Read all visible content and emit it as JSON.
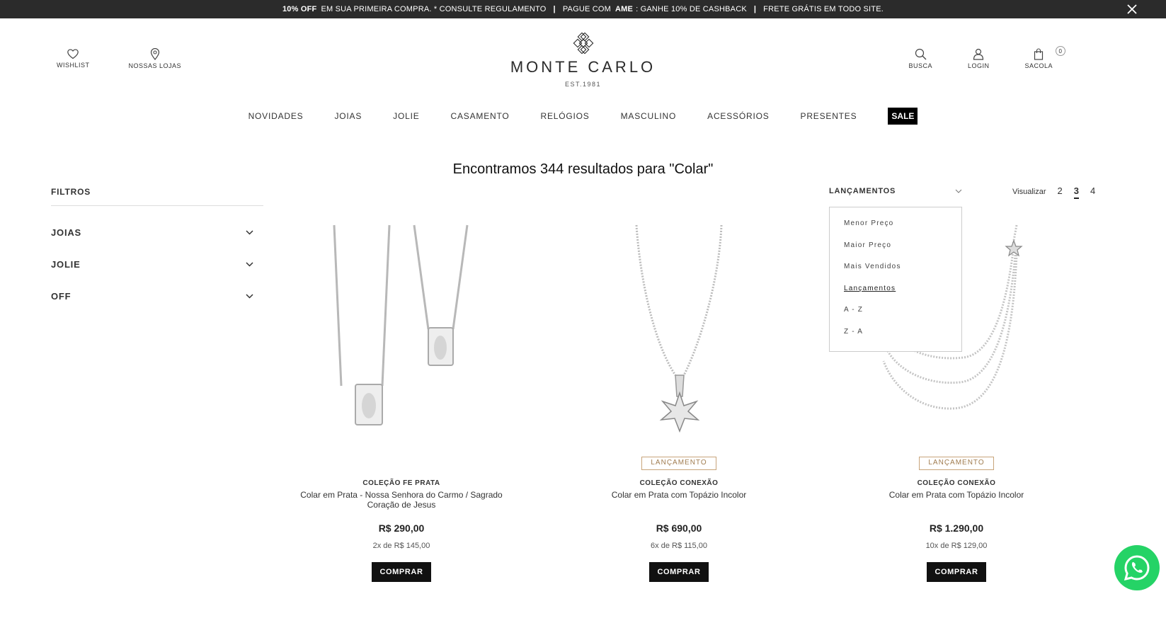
{
  "promo": {
    "part1_bold": "10% OFF",
    "part1": "EM SUA PRIMEIRA COMPRA. * CONSULTE REGULAMENTO",
    "part2_pre": "PAGUE COM",
    "part2_bold": "AME",
    "part2_post": ": GANHE 10% DE CASHBACK",
    "part3": "FRETE GRÁTIS EM TODO SITE.",
    "separator": "|"
  },
  "header": {
    "wishlist": "WISHLIST",
    "stores": "NOSSAS LOJAS",
    "search": "BUSCA",
    "login": "LOGIN",
    "bag": "SACOLA",
    "bag_count": "0",
    "logo_text": "MONTE CARLO",
    "logo_est": "EST.1981"
  },
  "nav": [
    "NOVIDADES",
    "JOIAS",
    "JOLIE",
    "CASAMENTO",
    "RELÓGIOS",
    "MASCULINO",
    "ACESSÓRIOS",
    "PRESENTES"
  ],
  "nav_sale": "SALE",
  "results_title": "Encontramos 344 resultados para \"Colar\"",
  "filters": {
    "title": "FILTROS",
    "items": [
      "JOIAS",
      "JOLIE",
      "OFF"
    ]
  },
  "sort": {
    "selected": "LANÇAMENTOS",
    "options": [
      "Menor Preço",
      "Maior Preço",
      "Mais Vendidos",
      "Lançamentos",
      "A - Z",
      "Z - A"
    ],
    "active_option": "Lançamentos"
  },
  "view": {
    "label": "Visualizar",
    "options": [
      "2",
      "3",
      "4"
    ],
    "active": "3"
  },
  "products": [
    {
      "badge": "",
      "collection": "COLEÇÃO FE PRATA",
      "name": "Colar em Prata - Nossa Senhora do Carmo / Sagrado Coração de Jesus",
      "price": "R$ 290,00",
      "installments": "2x de R$ 145,00",
      "buy": "COMPRAR"
    },
    {
      "badge": "LANÇAMENTO",
      "collection": "COLEÇÃO CONEXÃO",
      "name": "Colar em Prata com Topázio Incolor",
      "price": "R$ 690,00",
      "installments": "6x de R$ 115,00",
      "buy": "COMPRAR"
    },
    {
      "badge": "LANÇAMENTO",
      "collection": "COLEÇÃO CONEXÃO",
      "name": "Colar em Prata com Topázio Incolor",
      "price": "R$ 1.290,00",
      "installments": "10x de R$ 129,00",
      "buy": "COMPRAR"
    }
  ],
  "colors": {
    "promo_bg": "#2b2b2b",
    "badge": "#a07c4f",
    "buy_bg": "#111111",
    "whatsapp": "#25d366"
  }
}
